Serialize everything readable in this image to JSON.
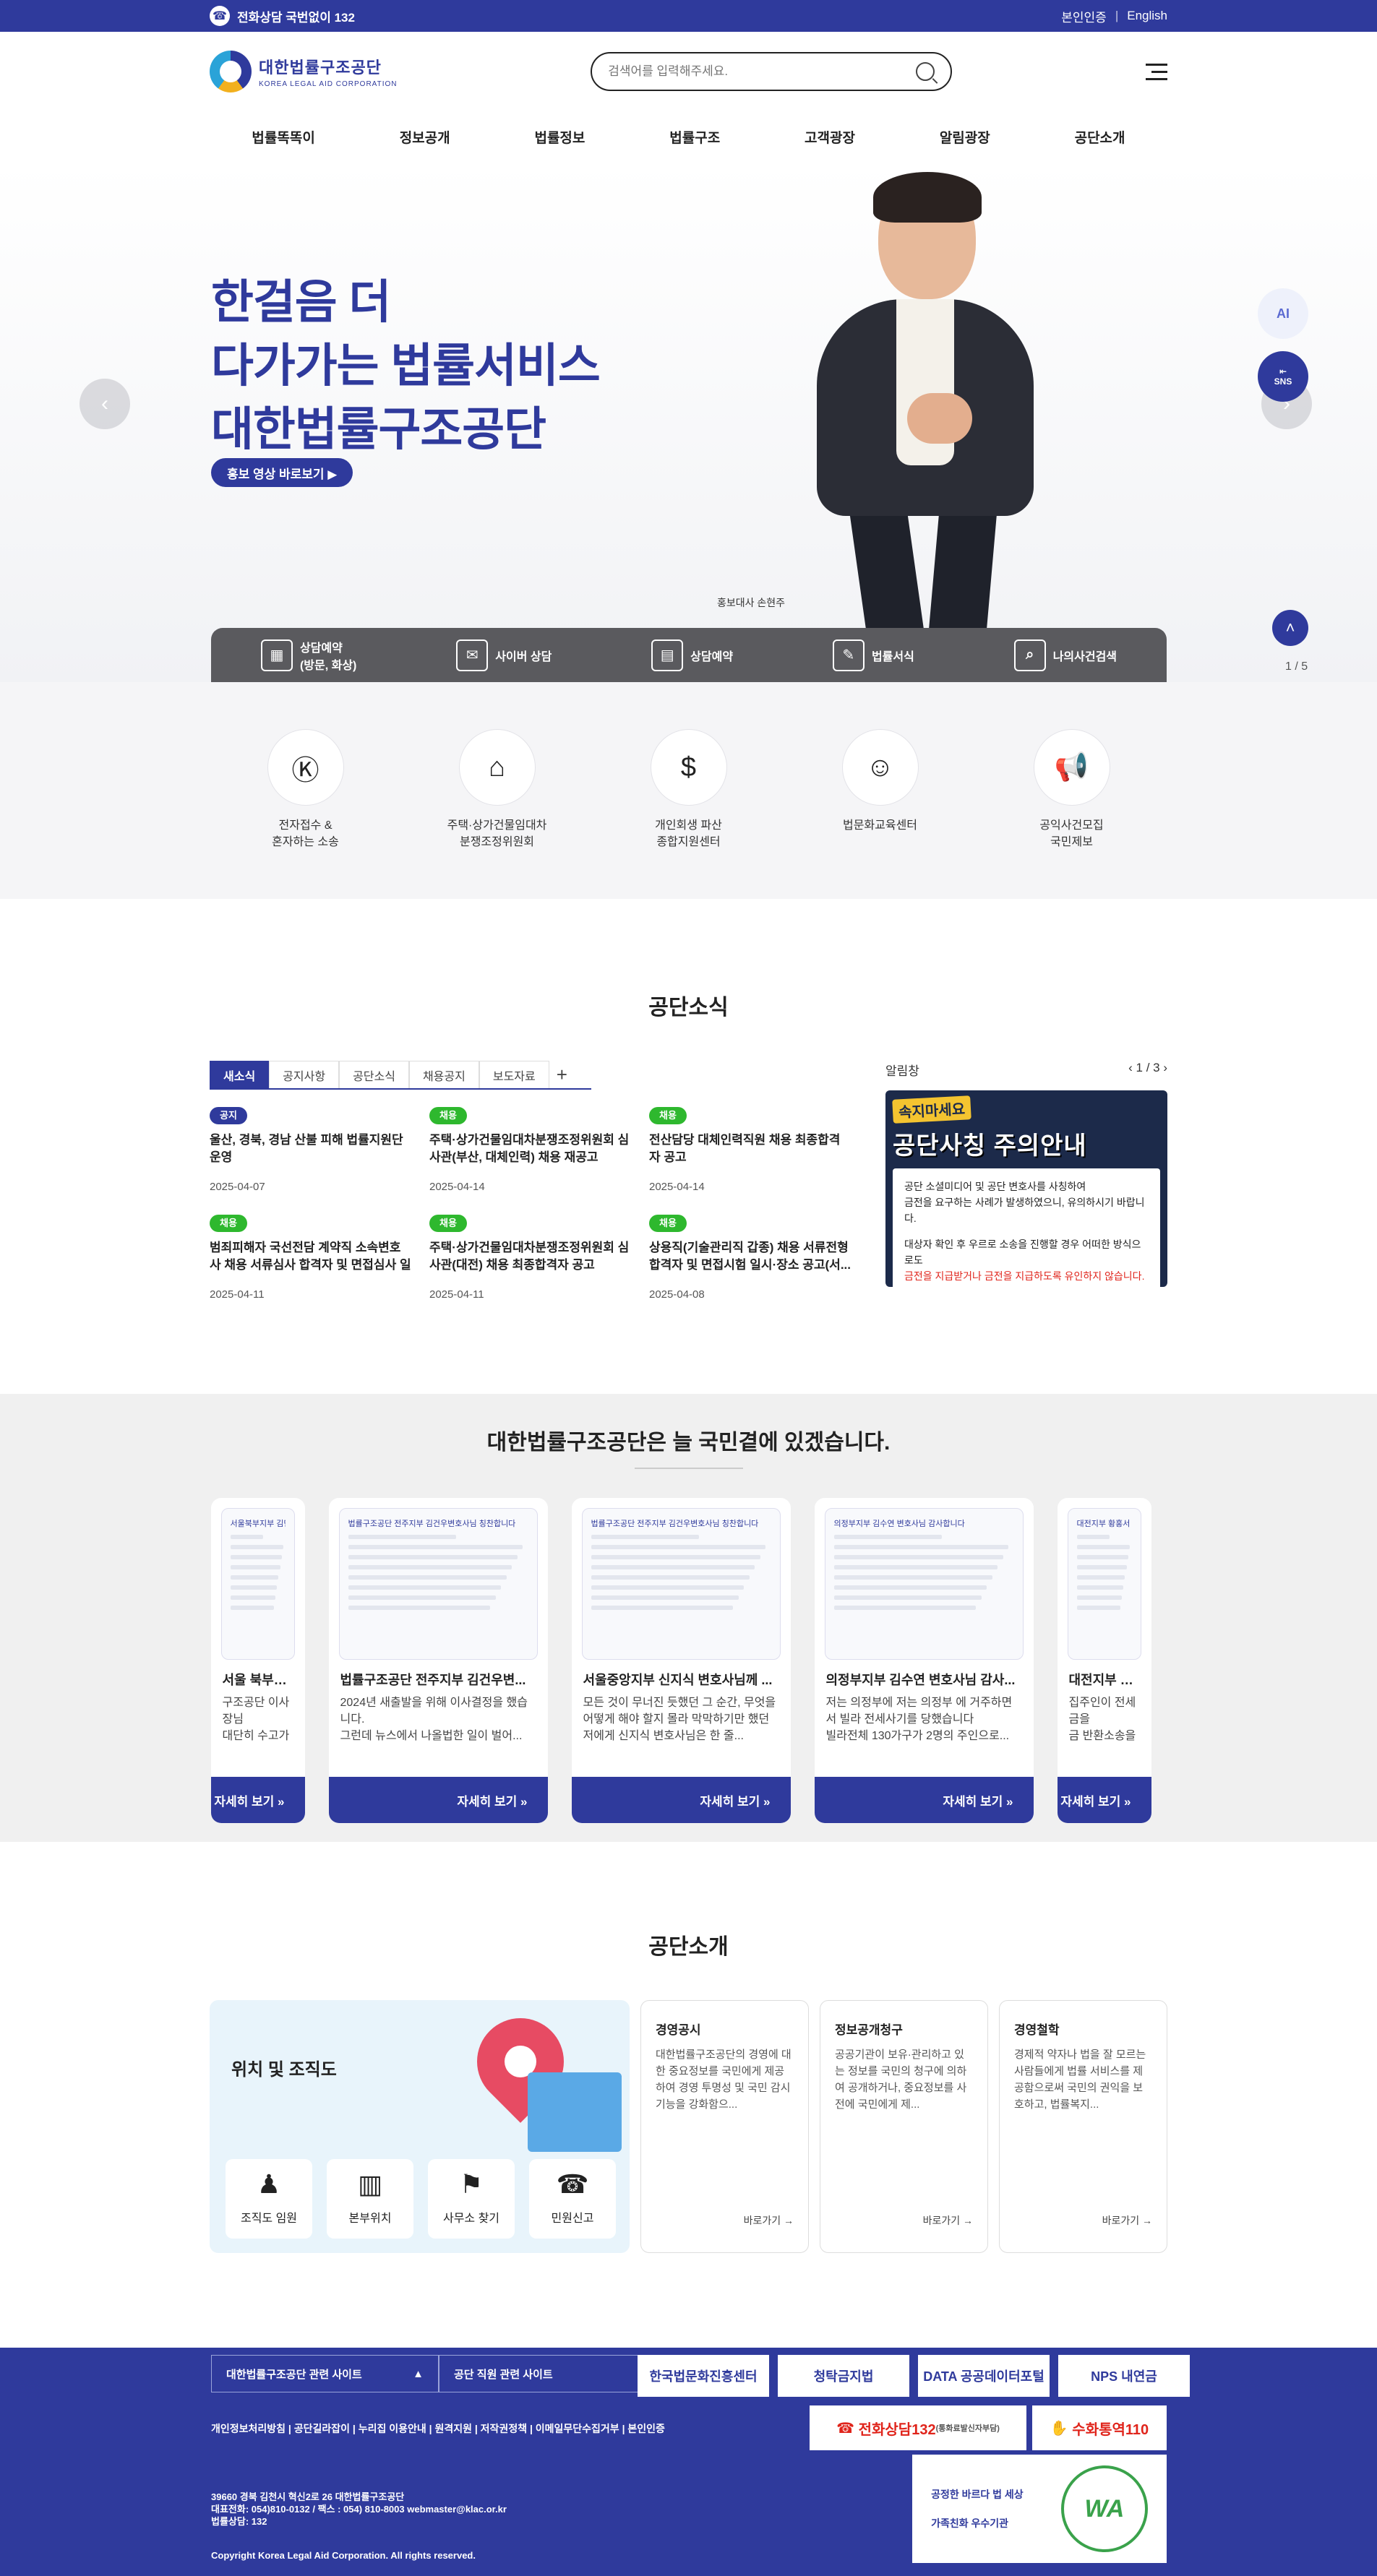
{
  "topbar": {
    "phone": "전화상담 국번없이 132",
    "auth": "본인인증",
    "sep": "|",
    "lang": "English"
  },
  "header": {
    "logo_ko": "대한법률구조공단",
    "logo_en": "KOREA LEGAL AID CORPORATION",
    "search_placeholder": "검색어를 입력해주세요."
  },
  "gnb": [
    "법률똑똑이",
    "정보공개",
    "법률정보",
    "법률구조",
    "고객광장",
    "알림광장",
    "공단소개"
  ],
  "hero": {
    "line1": "한걸음 더",
    "line2": "다가가는 법률서비스",
    "line3": "대한법률구조공단",
    "video_button": "홍보 영상 바로보기 ▶",
    "ambassador": "홍보대사 손현주",
    "pager": "1 / 5",
    "sns": "SNS",
    "ai": "AI"
  },
  "quickbar": [
    {
      "icon": "calendar-icon",
      "glyph": "▦",
      "label": "상담예약\n(방문, 화상)"
    },
    {
      "icon": "cyber-counsel-icon",
      "glyph": "✉",
      "label": "사이버 상담"
    },
    {
      "icon": "document-icon",
      "glyph": "▤",
      "label": "상담예약"
    },
    {
      "icon": "form-icon",
      "glyph": "✎",
      "label": "법률서식"
    },
    {
      "icon": "search-case-icon",
      "glyph": "⌕",
      "label": "나의사건검색"
    }
  ],
  "quick_icons": [
    {
      "icon": "ecourt-icon",
      "glyph": "Ⓚ",
      "label": "전자접수 &\n혼자하는 소송"
    },
    {
      "icon": "house-search-icon",
      "glyph": "⌂",
      "label": "주택·상가건물임대차\n분쟁조정위원회"
    },
    {
      "icon": "coin-icon",
      "glyph": "$",
      "label": "개인회생 파산\n종합지원센터"
    },
    {
      "icon": "education-icon",
      "glyph": "☺",
      "label": "법문화교육센터"
    },
    {
      "icon": "megaphone-icon",
      "glyph": "📢",
      "label": "공익사건모집\n국민제보"
    }
  ],
  "news": {
    "title": "공단소식",
    "tabs": [
      "새소식",
      "공지사항",
      "공단소식",
      "채용공지",
      "보도자료"
    ],
    "plus": "+",
    "items": [
      {
        "badge": "공지",
        "badge_color": "#2f3a9c",
        "title": "울산, 경북, 경남 산불 피해 법률지원단 운영",
        "date": "2025-04-07"
      },
      {
        "badge": "채용",
        "badge_color": "#2eb82e",
        "title": "주택·상가건물임대차분쟁조정위원회 심사관(부산, 대체인력) 채용 재공고",
        "date": "2025-04-14"
      },
      {
        "badge": "채용",
        "badge_color": "#2eb82e",
        "title": "전산담당 대체인력직원 채용 최종합격자 공고",
        "date": "2025-04-14"
      },
      {
        "badge": "채용",
        "badge_color": "#2eb82e",
        "title": "범죄피해자 국선전담 계약직 소속변호사 채용 서류심사 합격자 및 면접심사 일정...",
        "date": "2025-04-11"
      },
      {
        "badge": "채용",
        "badge_color": "#2eb82e",
        "title": "주택·상가건물임대차분쟁조정위원회 심사관(대전) 채용 최종합격자 공고",
        "date": "2025-04-11"
      },
      {
        "badge": "채용",
        "badge_color": "#2eb82e",
        "title": "상용직(기술관리직 갑종) 채용 서류전형 합격자 및 면접시험 일시·장소 공고(서...",
        "date": "2025-04-08"
      }
    ],
    "notice_label": "알림창",
    "notice_pager": "1 / 3",
    "notice_tag": "속지마세요",
    "notice_headline": "공단사칭 주의안내",
    "notice_body1": "공단 소셜미디어 및 공단 변호사를 사칭하여",
    "notice_body2": "금전을 요구하는 사례가 발생하였으니, 유의하시기 바랍니다.",
    "notice_body3": "대상자 확인 후 우르로 소송을 진행할 경우 어떠한 방식으로도",
    "notice_body4": "금전을 지급받거나 금전을 지급하도록 유인하지 않습니다."
  },
  "story": {
    "title": "대한법률구조공단은 늘 국민곁에 있겠습니다.",
    "more": "자세히 보기 »",
    "cards": [
      {
        "thumb": "서울북부지부 김민서 변호사님 감사...",
        "title": "서울 북부지부 ...",
        "desc": "구조공단 이사장님\n대단히 수고가 많"
      },
      {
        "thumb": "법률구조공단 전주지부 김건우변호사님 칭찬합니다",
        "title": "법률구조공단 전주지부 김건우변...",
        "desc": "2024년 새출발을 위해 이사결정을 했습니다.\n그런데 뉴스에서 나올법한 일이 벌어..."
      },
      {
        "thumb": "법률구조공단 전주지부 김건우변호사님 칭찬합니다",
        "title": "서울중앙지부 신지식 변호사님께 ...",
        "desc": "모든 것이 무너진 듯했던 그 순간, 무엇을 어떻게 해야 할지 몰라 막막하기만 했던 저에게 신지식 변호사님은 한 줄..."
      },
      {
        "thumb": "의정부지부 김수연 변호사님 감사합니다",
        "title": "의정부지부 김수연 변호사님 감사...",
        "desc": "저는 의정부에 저는 의정부 에 거주하면서 빌라 전세사기를 당했습니다\n빌라전체 130가구가 2명의 주인으로..."
      },
      {
        "thumb": "대전지부 황홍서 변호사님 감사...",
        "title": "대전지부 황홍서 ...",
        "desc": "집주인이 전세금을\n금 반환소송을 진행\n이미 집주인과의 다"
      }
    ]
  },
  "intro": {
    "title": "공단소개",
    "location_title": "위치 및 조직도",
    "location_buttons": [
      {
        "icon": "org-chart-icon",
        "glyph": "♟",
        "label": "조직도 임원"
      },
      {
        "icon": "building-icon",
        "glyph": "▥",
        "label": "본부위치"
      },
      {
        "icon": "office-map-icon",
        "glyph": "⚑",
        "label": "사무소 찾기"
      },
      {
        "icon": "complaint-icon",
        "glyph": "☎",
        "label": "민원신고"
      }
    ],
    "cards": [
      {
        "title": "경영공시",
        "desc": "대한법률구조공단의 경영에 대한 중요정보를 국민에게 제공하여 경영 투명성 및 국민 감시 기능을 강화함으...",
        "go": "바로가기 →"
      },
      {
        "title": "정보공개청구",
        "desc": "공공기관이 보유·관리하고 있는 정보를 국민의 청구에 의하여 공개하거나, 중요정보를 사전에 국민에게 제...",
        "go": "바로가기 →"
      },
      {
        "title": "경영철학",
        "desc": "경제적 약자나 법을 잘 모르는 사람들에게 법률 서비스를 제공함으로써 국민의 권익을 보호하고, 법률복지...",
        "go": "바로가기 →"
      }
    ]
  },
  "footer": {
    "select1": "대한법률구조공단 관련 사이트",
    "select2": "공단 직원 관련 사이트",
    "logos": [
      "한국법문화진흥센터",
      "청탁금지법",
      "DATA 공공데이터포털",
      "NPS 내연금"
    ],
    "links": "개인정보처리방침 | 공단길라잡이 | 누리집 이용안내 | 원격지원 | 저작권정책 | 이메일무단수집거부 | 본인인증",
    "call": "전화상담132",
    "call_note": "(통화료발신자부담)",
    "sign": "수화통역110",
    "addr1": "39660 경북 김천시 혁신2로 26 대한법률구조공단",
    "addr2": "대표전화: 054)810-0132 / 팩스 : 054) 810-8003 webmaster@klac.or.kr",
    "addr3": "법률상담: 132",
    "copyright": "Copyright Korea Legal Aid Corporation. All rights reserved.",
    "cert1": "공정한 바르다 법 세상",
    "cert2": "가족친화 우수기관",
    "cert3": "WA"
  }
}
